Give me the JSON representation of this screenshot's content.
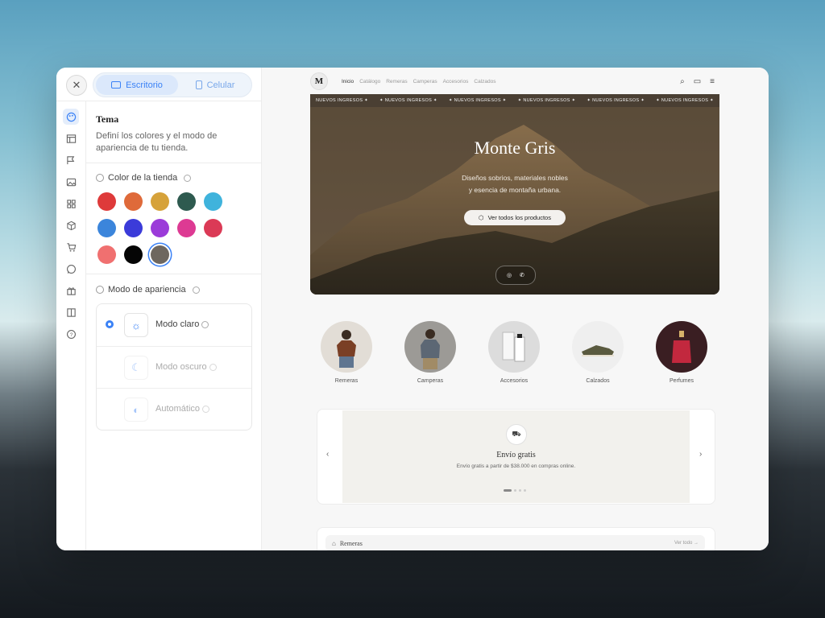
{
  "editor": {
    "device_tabs": {
      "desktop": "Escritorio",
      "mobile": "Celular"
    },
    "section_title": "Tema",
    "section_desc": "Definí los colores y el modo de apariencia de tu tienda.",
    "store_color_label": "Color de la tienda",
    "swatches": [
      "#de3a3a",
      "#df6a3a",
      "#d6a23a",
      "#2e5a4f",
      "#3fb3dc",
      "#3b85db",
      "#3b3bd9",
      "#9b3bd9",
      "#dd3a93",
      "#db3a56",
      "#f07070",
      "#050505",
      "#6e675f"
    ],
    "selected_swatch": "#6e675f",
    "appearance_label": "Modo de apariencia",
    "modes": [
      {
        "label": "Modo claro",
        "icon": "sun-icon",
        "selected": true
      },
      {
        "label": "Modo oscuro",
        "icon": "moon-icon",
        "selected": false
      },
      {
        "label": "Automático",
        "icon": "half-circle-icon",
        "selected": false
      }
    ],
    "rail_icons": [
      "palette-icon",
      "layout-icon",
      "flag-icon",
      "image-icon",
      "grid-icon",
      "box-icon",
      "cart-icon",
      "whatsapp-icon",
      "gift-icon",
      "columns-icon",
      "help-icon"
    ]
  },
  "site": {
    "logo_text": "M",
    "nav_links": [
      "Inicio",
      "Catálogo",
      "Remeras",
      "Camperas",
      "Accesorios",
      "Calzados"
    ],
    "marquee": [
      "NUEVOS INGRESOS ✦",
      "✦ NUEVOS INGRESOS ✦",
      "✦ NUEVOS INGRESOS ✦",
      "✦ NUEVOS INGRESOS ✦",
      "✦ NUEVOS INGRESOS ✦",
      "✦ NUEVOS INGRESOS ✦"
    ],
    "hero_title": "Monte Gris",
    "hero_sub_1": "Diseños sobrios, materiales nobles",
    "hero_sub_2": "y esencia de montaña urbana.",
    "hero_button": "Ver todos los productos",
    "categories": [
      "Remeras",
      "Camperas",
      "Accesorios",
      "Calzados",
      "Perfumes"
    ],
    "promo_title": "Envío gratis",
    "promo_text": "Envío gratis a partir de $38.000 en compras online.",
    "section_title": "Remeras",
    "see_all": "Ver todo →"
  },
  "side_tools": [
    "fullscreen-icon",
    "refresh-icon",
    "home-icon",
    "undo-icon",
    "redo-icon",
    "hide-icon"
  ]
}
